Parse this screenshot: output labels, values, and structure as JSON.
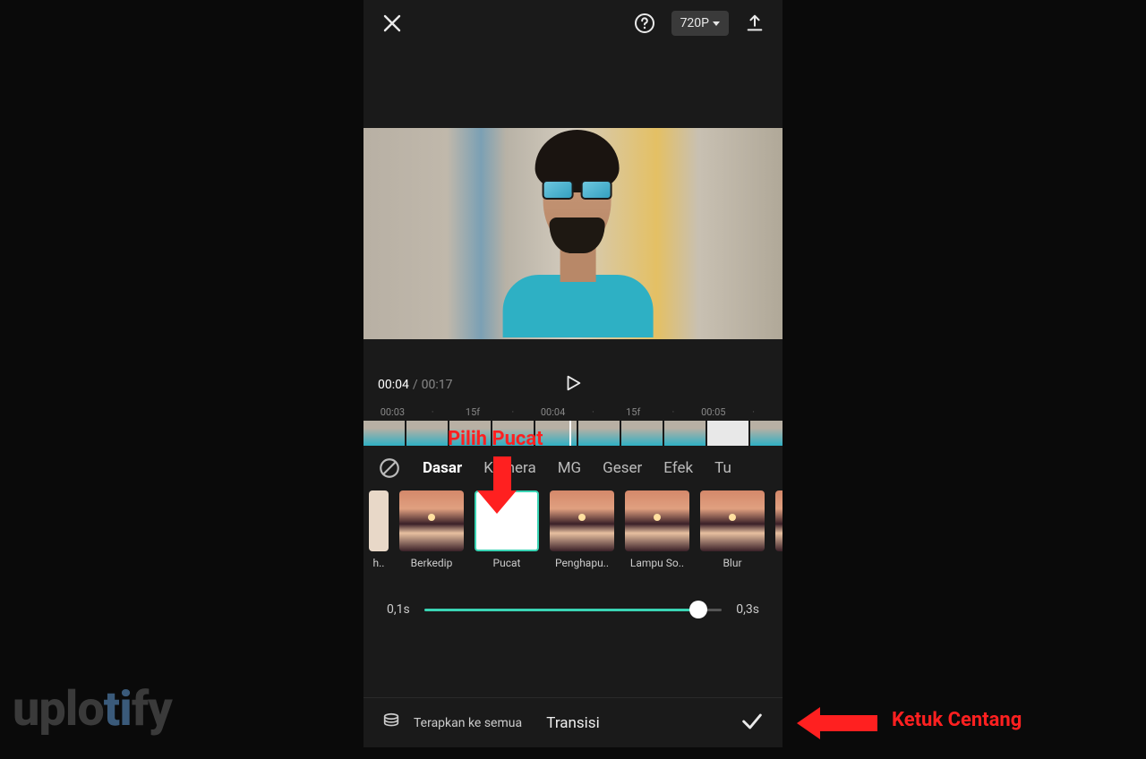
{
  "topbar": {
    "resolution": "720P"
  },
  "player": {
    "current_time": "00:04",
    "separator": " / ",
    "duration": "00:17"
  },
  "ruler": {
    "marks": [
      "00:03",
      "·",
      "15f",
      "·",
      "00:04",
      "·",
      "15f",
      "·",
      "00:05",
      "·"
    ]
  },
  "annotations": {
    "pick_label": "Pilih Pucat",
    "confirm_label": "Ketuk Centang"
  },
  "categories": {
    "items": [
      "Dasar",
      "Kamera",
      "MG",
      "Geser",
      "Efek",
      "Tu"
    ],
    "active_index": 0
  },
  "effects": {
    "items": [
      {
        "label": "h.."
      },
      {
        "label": "Berkedip"
      },
      {
        "label": "Pucat",
        "selected": true
      },
      {
        "label": "Penghapu.."
      },
      {
        "label": "Lampu So.."
      },
      {
        "label": "Blur"
      },
      {
        "label": ""
      }
    ]
  },
  "slider": {
    "min_label": "0,1s",
    "max_label": "0,3s"
  },
  "bottom": {
    "apply_all": "Terapkan ke semua",
    "title": "Transisi"
  },
  "watermark": {
    "p1": "uplo",
    "p2": "ti",
    "p3": "fy"
  }
}
